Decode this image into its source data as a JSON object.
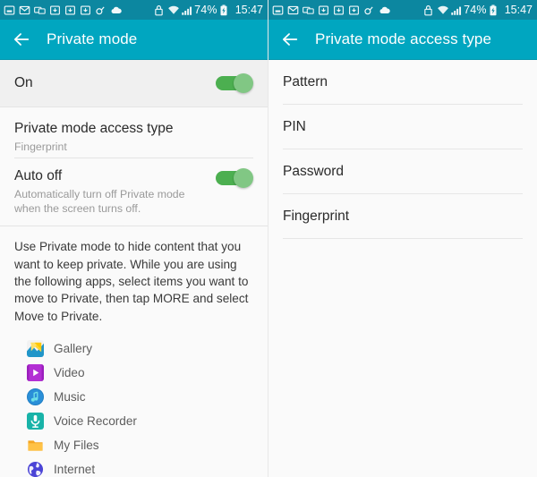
{
  "statusbar": {
    "icons": [
      "inbox-icon",
      "email-icon",
      "chat-icon",
      "save-icon",
      "save-icon",
      "save-icon",
      "link-icon",
      "cloud-icon"
    ],
    "secure_icon": "lock-icon",
    "wifi_icon": "wifi-icon",
    "signal_icon": "signal-bars-icon",
    "battery_percent": "74%",
    "battery_icon": "battery-charging-icon",
    "time": "15:47"
  },
  "left_panel": {
    "appbar": {
      "back_icon": "back-arrow-icon",
      "title": "Private mode"
    },
    "toggle_row": {
      "label": "On",
      "toggle_state": "on"
    },
    "access_type_row": {
      "title": "Private mode access type",
      "subtitle": "Fingerprint"
    },
    "auto_off_row": {
      "title": "Auto off",
      "subtitle": "Automatically turn off Private mode when the screen turns off.",
      "toggle_state": "on"
    },
    "description": "Use Private mode to hide content that you want to keep private. While you are using the following apps, select items you want to move to Private, then tap MORE and select Move to Private.",
    "apps": [
      {
        "name": "Gallery",
        "icon": "gallery-icon"
      },
      {
        "name": "Video",
        "icon": "video-icon"
      },
      {
        "name": "Music",
        "icon": "music-icon"
      },
      {
        "name": "Voice Recorder",
        "icon": "voice-recorder-icon"
      },
      {
        "name": "My Files",
        "icon": "my-files-icon"
      },
      {
        "name": "Internet",
        "icon": "internet-icon"
      }
    ]
  },
  "right_panel": {
    "appbar": {
      "back_icon": "back-arrow-icon",
      "title": "Private mode access type"
    },
    "options": [
      {
        "label": "Pattern"
      },
      {
        "label": "PIN"
      },
      {
        "label": "Password"
      },
      {
        "label": "Fingerprint"
      }
    ]
  },
  "colors": {
    "appbar_teal": "#00a6c0",
    "statusbar_teal": "#0c87a0",
    "toggle_track_green": "#4caf50",
    "toggle_thumb_green": "#81c784",
    "row_background": "#fafafa",
    "selected_row_background": "#f0f0f0"
  }
}
